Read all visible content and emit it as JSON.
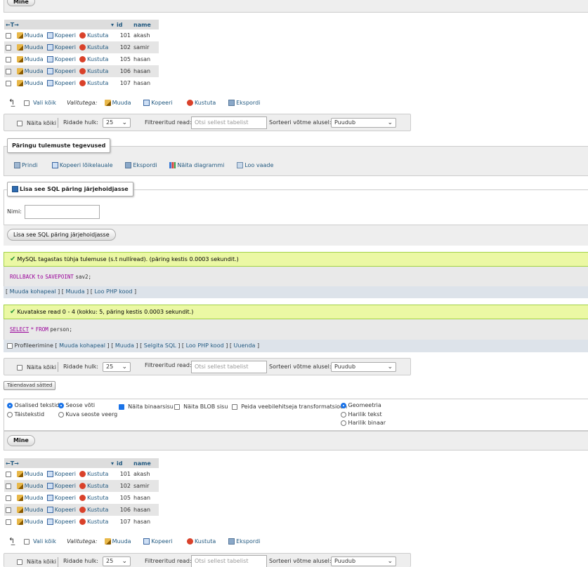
{
  "go_button": "Mine",
  "table": {
    "headers": {
      "id": "id",
      "name": "name"
    },
    "action_labels": {
      "edit": "Muuda",
      "copy": "Kopeeri",
      "delete": "Kustuta"
    },
    "rows": [
      {
        "id": "101",
        "name": "akash"
      },
      {
        "id": "102",
        "name": "samir"
      },
      {
        "id": "105",
        "name": "hasan"
      },
      {
        "id": "106",
        "name": "hasan"
      },
      {
        "id": "107",
        "name": "hasan"
      }
    ]
  },
  "bulk": {
    "select_all": "Vali kõik",
    "with_selected": "Valitutega:",
    "edit": "Muuda",
    "copy": "Kopeeri",
    "delete": "Kustuta",
    "export": "Ekspordi"
  },
  "nav": {
    "show_all": "Näita kõiki",
    "rows_label": "Ridade hulk:",
    "rows_value": "25",
    "filter_label": "Filtreeritud read:",
    "filter_placeholder": "Otsi sellest tabelist",
    "sort_label": "Sorteeri võtme alusel:",
    "sort_value": "Puudub"
  },
  "query_ops": {
    "legend": "Päringu tulemuste tegevused",
    "print": "Prindi",
    "copy_clipboard": "Kopeeri lõikelauale",
    "export": "Ekspordi",
    "chart": "Näita diagrammi",
    "create_view": "Loo vaade"
  },
  "bookmark": {
    "legend": "Lisa see SQL päring järjehoidjasse",
    "name_label": "Nimi:",
    "submit": "Lisa see SQL päring järjehoidjasse"
  },
  "msg1": {
    "text": "MySQL tagastas tühja tulemuse (s.t nullíread). (päring kestis 0.0003 sekundit.)",
    "sql_kw1": "ROLLBACK",
    "sql_kw2": "to",
    "sql_kw3": "SAVEPOINT",
    "sql_rest": "sav2;",
    "links": [
      "Muuda kohapeal",
      "Muuda",
      "Loo PHP kood"
    ]
  },
  "msg2": {
    "text": "Kuvatakse read 0 - 4 (kokku: 5, päring kestis 0.0003 sekundit.)",
    "sql_kw1": "SELECT",
    "sql_star": "*",
    "sql_kw2": "FROM",
    "sql_rest": "person;",
    "profiling": "Profileerimine",
    "links": [
      "Muuda kohapeal",
      "Muuda",
      "Selgita SQL",
      "Loo PHP kood",
      "Uuenda"
    ]
  },
  "extra_options": "Täiendavad sätted",
  "options": {
    "partial_texts": "Osalised tekstid",
    "full_texts": "Täistekstid",
    "relational_key": "Seose võti",
    "relational_display": "Kuva seoste veerg",
    "show_binary": "Näita binaarsisu",
    "show_blob": "Näita BLOB sisu",
    "hide_transform": "Peida veebilehitseja transformatsioon",
    "geometry": "Geomeetria",
    "wkt": "Harilik tekst",
    "wkb": "Harilik binaar"
  }
}
